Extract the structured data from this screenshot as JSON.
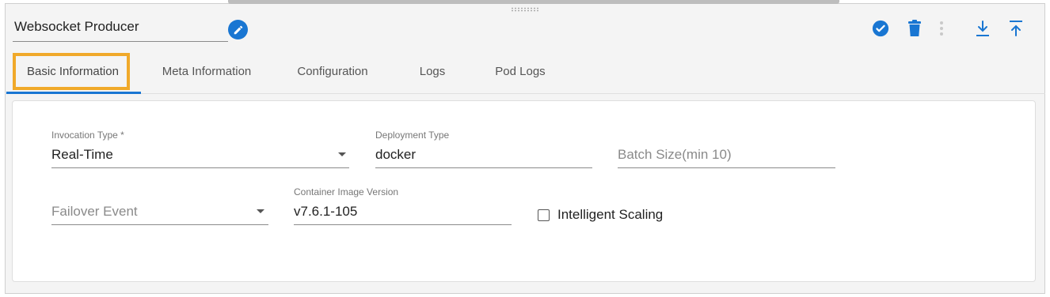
{
  "header": {
    "name_value": "Websocket Producer",
    "icons": {
      "edit": "pencil-icon",
      "validate": "check-circle-icon",
      "delete": "trash-icon",
      "more": "more-vertical-icon",
      "download": "download-icon",
      "upload": "upload-icon"
    },
    "accent_color": "#1976d2"
  },
  "tabs": [
    {
      "label": "Basic Information",
      "active": true
    },
    {
      "label": "Meta Information",
      "active": false
    },
    {
      "label": "Configuration",
      "active": false
    },
    {
      "label": "Logs",
      "active": false
    },
    {
      "label": "Pod Logs",
      "active": false
    }
  ],
  "form": {
    "invocation_type": {
      "label": "Invocation Type *",
      "value": "Real-Time"
    },
    "deployment_type": {
      "label": "Deployment Type",
      "value": "docker"
    },
    "batch_size": {
      "placeholder": "Batch Size(min 10)"
    },
    "failover_event": {
      "placeholder": "Failover Event"
    },
    "container_image_version": {
      "label": "Container Image Version",
      "value": "v7.6.1-105"
    },
    "intelligent_scaling": {
      "label": "Intelligent Scaling",
      "checked": false
    }
  },
  "highlight_color": "#f0a92a"
}
